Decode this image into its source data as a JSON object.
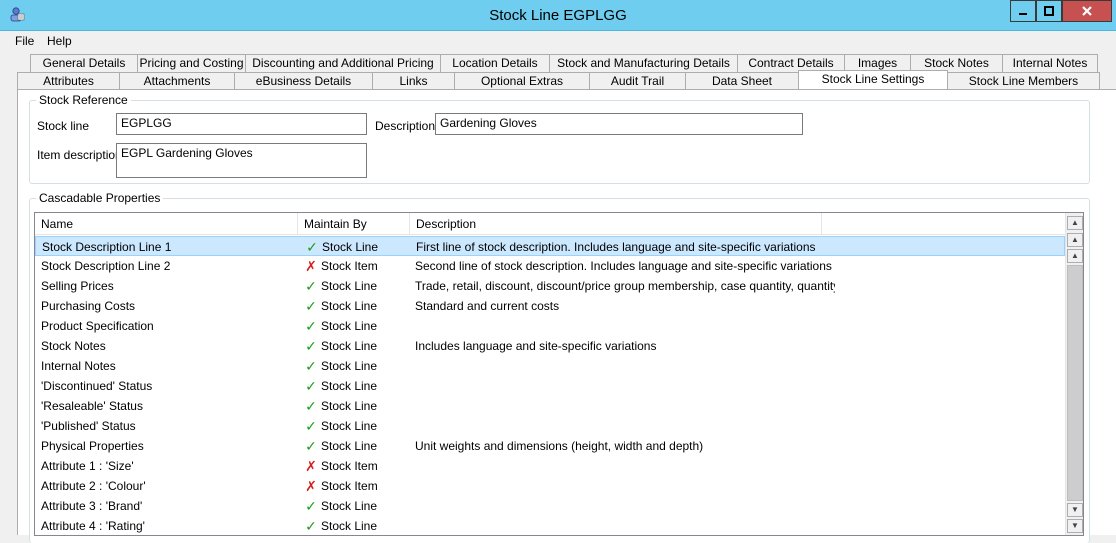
{
  "window": {
    "title": "Stock Line EGPLGG",
    "icon": "app-user-icon",
    "controls": [
      "minimize-icon",
      "maximize-icon",
      "close-icon"
    ],
    "accent": "#6fcdf0",
    "close_color": "#c75050"
  },
  "menu": {
    "file": "File",
    "help": "Help"
  },
  "tabs_row1": [
    "General Details",
    "Pricing and Costing",
    "Discounting and Additional Pricing",
    "Location Details",
    "Stock and Manufacturing Details",
    "Contract Details",
    "Images",
    "Stock Notes",
    "Internal Notes"
  ],
  "tabs_row2": [
    "Attributes",
    "Attachments",
    "eBusiness Details",
    "Links",
    "Optional Extras",
    "Audit Trail",
    "Data Sheet",
    "Stock Line Settings",
    "Stock Line Members"
  ],
  "active_tab": "Stock Line Settings",
  "stock_reference": {
    "title": "Stock Reference",
    "stock_line_label": "Stock line",
    "stock_line_value": "EGPLGG",
    "description_label": "Description",
    "description_value": "Gardening Gloves",
    "item_description_label": "Item description",
    "item_description_value": "EGPL Gardening Gloves"
  },
  "cascadable": {
    "title": "Cascadable Properties",
    "columns": {
      "name": "Name",
      "maintain": "Maintain By",
      "description": "Description"
    },
    "rows": [
      {
        "name": "Stock Description Line 1",
        "mark": "✓",
        "maintain": "Stock Line",
        "description": "First line of stock description. Includes language and site-specific variations"
      },
      {
        "name": "Stock Description Line 2",
        "mark": "✗",
        "maintain": "Stock Item",
        "description": "Second line of stock description. Includes language and site-specific variations"
      },
      {
        "name": "Selling Prices",
        "mark": "✓",
        "maintain": "Stock Line",
        "description": "Trade, retail, discount, discount/price group membership, case quantity, quantity br..."
      },
      {
        "name": "Purchasing Costs",
        "mark": "✓",
        "maintain": "Stock Line",
        "description": "Standard and current costs"
      },
      {
        "name": "Product Specification",
        "mark": "✓",
        "maintain": "Stock Line",
        "description": ""
      },
      {
        "name": "Stock Notes",
        "mark": "✓",
        "maintain": "Stock Line",
        "description": "Includes language and site-specific variations"
      },
      {
        "name": "Internal Notes",
        "mark": "✓",
        "maintain": "Stock Line",
        "description": ""
      },
      {
        "name": "'Discontinued' Status",
        "mark": "✓",
        "maintain": "Stock Line",
        "description": ""
      },
      {
        "name": "'Resaleable' Status",
        "mark": "✓",
        "maintain": "Stock Line",
        "description": ""
      },
      {
        "name": "'Published' Status",
        "mark": "✓",
        "maintain": "Stock Line",
        "description": ""
      },
      {
        "name": "Physical Properties",
        "mark": "✓",
        "maintain": "Stock Line",
        "description": "Unit weights and dimensions (height, width and depth)"
      },
      {
        "name": "Attribute 1 : 'Size'",
        "mark": "✗",
        "maintain": "Stock Item",
        "description": ""
      },
      {
        "name": "Attribute 2 : 'Colour'",
        "mark": "✗",
        "maintain": "Stock Item",
        "description": ""
      },
      {
        "name": "Attribute 3 : 'Brand'",
        "mark": "✓",
        "maintain": "Stock Line",
        "description": ""
      },
      {
        "name": "Attribute 4 : 'Rating'",
        "mark": "✓",
        "maintain": "Stock Line",
        "description": ""
      }
    ],
    "check_color": "#1a9a1a",
    "cross_color": "#d42020",
    "selected_row": 0
  }
}
